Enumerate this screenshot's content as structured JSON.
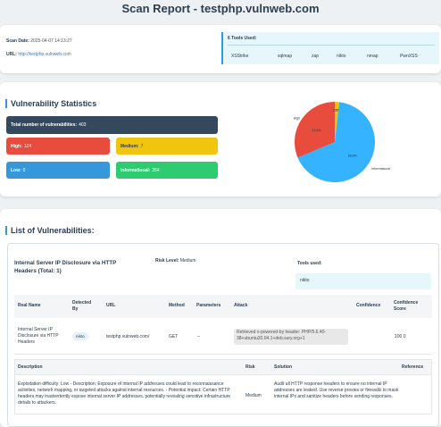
{
  "title": "Scan Report - testphp.vulnweb.com",
  "scan": {
    "date_label": "Scan Date:",
    "date_value": "2025-04-07 14:13:27",
    "url_label": "URL:",
    "url_value": "http://testphp.vulnweb.com"
  },
  "tools": {
    "title": "6 Tools Used:",
    "items": [
      "XSStrike",
      "sqlmap",
      "zap",
      "nikto",
      "nmap",
      "PwnXSS"
    ]
  },
  "stats": {
    "heading": "Vulnerability Statistics",
    "total_label": "Total number of vulnerabilities:",
    "total_value": "403",
    "high_label": "High:",
    "high_value": "124",
    "medium_label": "Medium:",
    "medium_value": "7",
    "low_label": "Low:",
    "low_value": "0",
    "info_label": "Informational:",
    "info_value": "264",
    "colors": {
      "total": "#34495e",
      "high": "#e74c3c",
      "medium": "#f1c40f",
      "low": "#3498db",
      "info": "#2ecc71"
    }
  },
  "chart_data": {
    "type": "pie",
    "slices": [
      {
        "label": "High",
        "value": 124,
        "pct": "31.6%",
        "color": "#e74c3c"
      },
      {
        "label": "Medium",
        "value": 7,
        "pct": "1.8%",
        "color": "#f1c40f"
      },
      {
        "label": "Low",
        "value": 0,
        "pct": "0.0%",
        "color": "#3498db"
      },
      {
        "label": "Informational",
        "value": 264,
        "pct": "66.6%",
        "color": "#36b3ff"
      }
    ]
  },
  "list": {
    "heading": "List of Vulnerabilities:",
    "vuln_title": "Internal Server IP Disclosure via HTTP Headers (Total: 1)",
    "risk_label": "Risk Level:",
    "risk_value": "Medium",
    "tools_used_label": "Tools used:",
    "tools_used_value": "nikto",
    "table_headers": [
      "Real Name",
      "Detected By",
      "URL",
      "Method",
      "Parameters",
      "Attack",
      "Confidence",
      "Confidence Score"
    ],
    "row": {
      "real_name": "Internal Server IP Disclosure via HTTP Headers",
      "detected_by": "nikto",
      "url": "testphp.vulnweb.com/",
      "method": "GET",
      "parameters": "–",
      "attack": "Retrieved x-powered-by header: PHP/5.6.40-38+ubuntu20.04.1+deb.sury.org+1",
      "confidence": "",
      "confidence_score": "100.0"
    },
    "detail_headers": [
      "Description",
      "Risk",
      "Solution",
      "Reference"
    ],
    "detail": {
      "description": "Exploitation difficulty: Low - Description: Exposure of internal IP addresses could lead to reconnaissance activities, network mapping, or targeted attacks against internal resources. - Potential impact: Certain HTTP headers may inadvertently expose internal server IP addresses, potentially revealing sensitive infrastructure details to attackers.",
      "risk": "Medium",
      "solution": "Audit all HTTP response headers to ensure no internal IP addresses are leaked. Use reverse proxies or firewalls to mask internal IPs and sanitize headers before sending responses.",
      "reference": ""
    }
  }
}
